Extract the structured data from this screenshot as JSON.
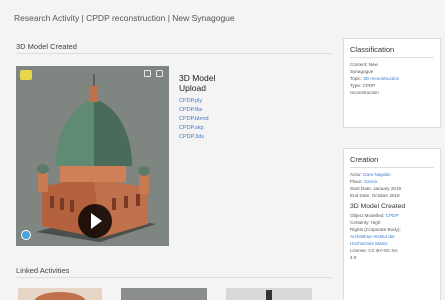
{
  "breadcrumb": "Research Activity | CPDP reconstruction | New Synagogue",
  "section": {
    "model_title": "3D Model Created",
    "linked_title": "Linked Activities"
  },
  "upload": {
    "heading_line1": "3D Model",
    "heading_line2": "Upload",
    "files": [
      "CPDP.ply",
      "CPDP.fbx",
      "CPDP.blend",
      "CPDP.skp",
      "CPDP.3ds"
    ]
  },
  "classification": {
    "title": "Classification",
    "content_label": "Content:",
    "content_value": "New",
    "content_value2": "Synagogue",
    "topic_label": "Topic:",
    "topic_value": "3D reconstruction",
    "type_label": "Type:",
    "type_value": "CPDP",
    "type_value2": "reconstruction"
  },
  "creation": {
    "title": "Creation",
    "actor_label": "Actor:",
    "actor_value": "Dora Nagdan",
    "place_label": "Place:",
    "place_value": "Szeria",
    "start_label": "Start Date:",
    "start_value": "January 2019",
    "end_label": "End Date:",
    "end_value": "October 2019",
    "sub_title": "3D Model Created",
    "obj_label": "Object Modelled:",
    "obj_value": "CPDP",
    "certainty_label": "Certainty:",
    "certainty_value": "High",
    "rights_label": "Rights (Corporate Body):",
    "rights_line2": "Architektur-Institut der",
    "rights_line3": "Hochschule Mainz",
    "license_line1": "License: CC BY-NC-SA",
    "license_line2": "4.0"
  },
  "colors": {
    "link": "#3a7bc8",
    "dome": "#4a6b59",
    "brick": "#c0704a"
  }
}
